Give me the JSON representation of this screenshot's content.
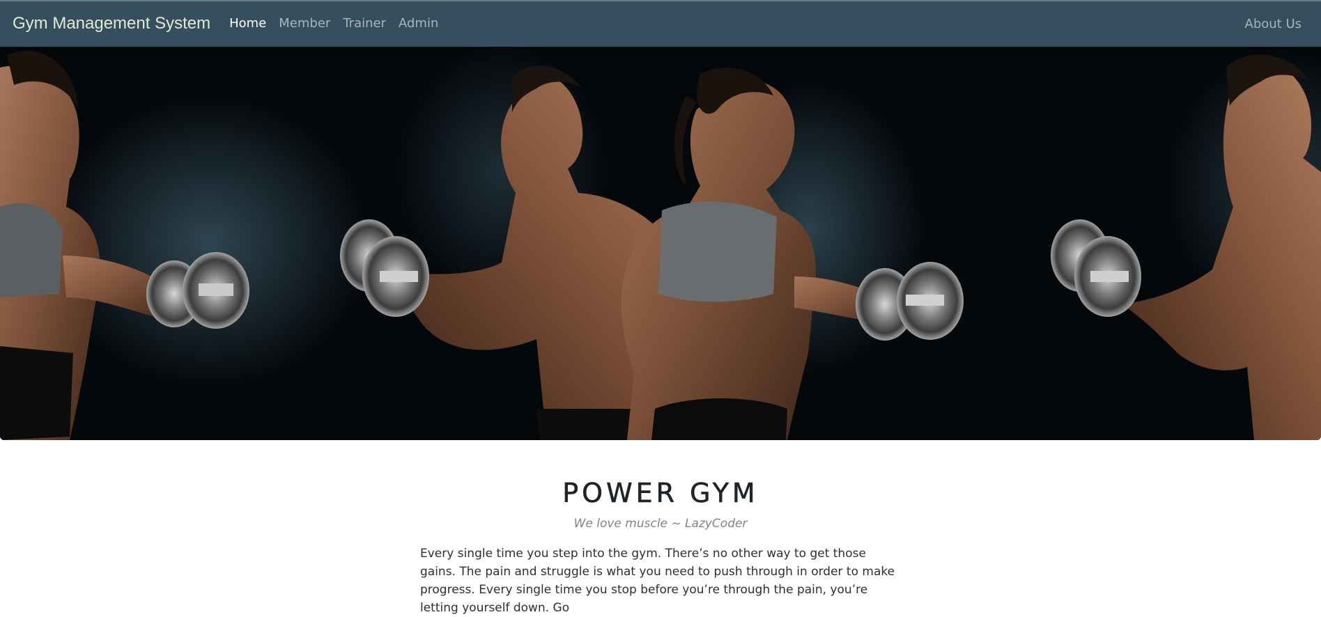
{
  "navbar": {
    "brand": "Gym Management System",
    "links": [
      {
        "label": "Home",
        "active": true
      },
      {
        "label": "Member",
        "active": false
      },
      {
        "label": "Trainer",
        "active": false
      },
      {
        "label": "Admin",
        "active": false
      }
    ],
    "right_link": "About Us"
  },
  "hero": {
    "image": "fitness-couple-with-dumbbells-photo"
  },
  "main": {
    "title": "POWER GYM",
    "tagline": "We love muscle ~ LazyCoder",
    "paragraph": "Every single time you step into the gym. There’s no other way to get those gains. The pain and struggle is what you need to push through in order to make progress. Every single time you stop before you’re through the pain, you’re letting yourself down. Go"
  },
  "colors": {
    "navbar_bg": "#364f5e",
    "brand_text": "#e4ead2",
    "nav_inactive": "#a9b4ba",
    "nav_active": "#ffffff",
    "title_text": "#1f2428",
    "tagline_text": "#7d858a"
  }
}
